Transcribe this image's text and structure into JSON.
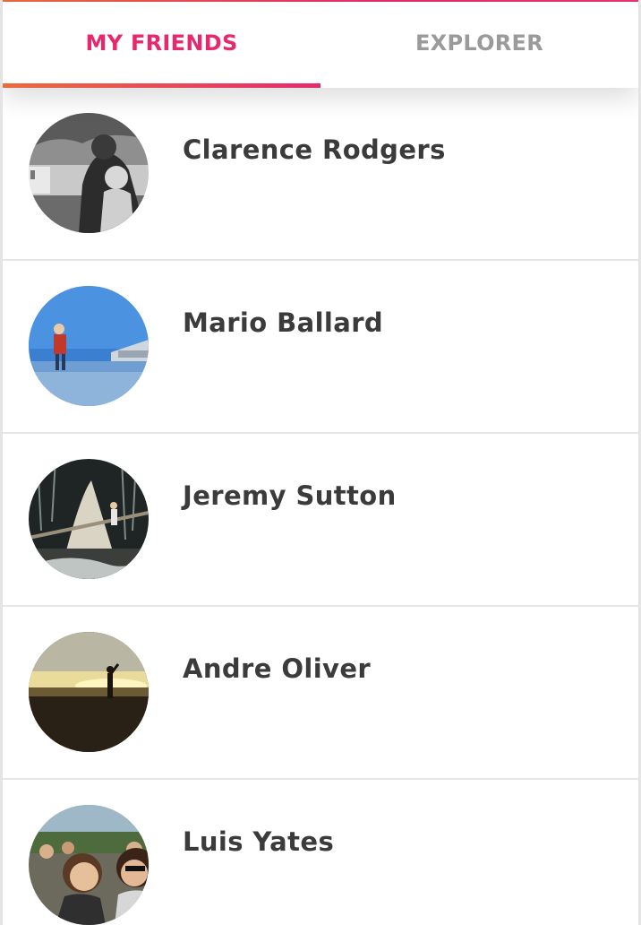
{
  "tabs": [
    {
      "label": "MY FRIENDS",
      "active": true
    },
    {
      "label": "EXPLORER",
      "active": false
    }
  ],
  "colors": {
    "accent": "#e7286c",
    "accent_gradient_start": "#ec6a3d",
    "inactive_tab": "#9a9a9a",
    "name_text": "#3b3b3b",
    "divider": "#e6e6e6"
  },
  "friends": [
    {
      "name": "Clarence Rodgers",
      "avatar": "black-and-white photo of adult holding baby"
    },
    {
      "name": "Mario Ballard",
      "avatar": "child standing on beach by the sea"
    },
    {
      "name": "Jeremy Sutton",
      "avatar": "child in a dark forest"
    },
    {
      "name": "Andre Oliver",
      "avatar": "silhouette in a field at sunset"
    },
    {
      "name": "Luis Yates",
      "avatar": "smiling people in a crowd"
    }
  ]
}
